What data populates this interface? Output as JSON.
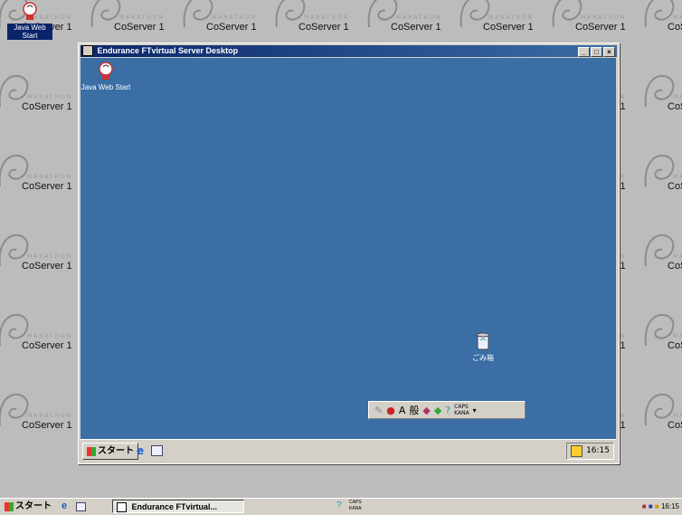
{
  "wallpaper": {
    "brand": "MARATHON",
    "tile_text": "CoServer 1"
  },
  "host_desktop": {
    "icon_label": "Java Web Start"
  },
  "window": {
    "title": "Endurance FTvirtual Server Desktop",
    "min_glyph": "_",
    "max_glyph": "□",
    "close_glyph": "×"
  },
  "remote_desktop": {
    "java_icon_label": "Java Web Start",
    "recycle_label": "ごみ箱",
    "langbar": {
      "ime_a": "A",
      "ime_mode": "般",
      "caps": "CAPS",
      "kana": "KANA"
    },
    "taskbar": {
      "start_label": "スタート",
      "clock": "16:15"
    }
  },
  "host_taskbar": {
    "start_label": "スタート",
    "task_label": "Endurance FTvirtual...",
    "caps": "CAPS",
    "kana": "KANA",
    "clock": "16:15"
  }
}
